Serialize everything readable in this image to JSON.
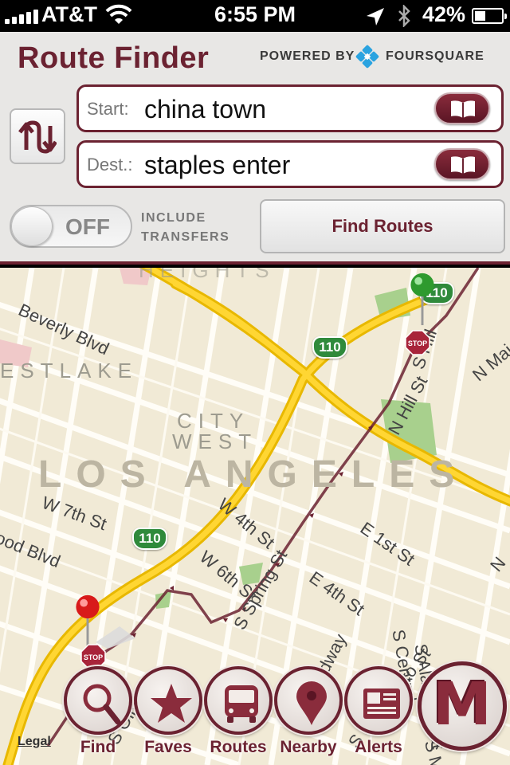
{
  "status_bar": {
    "carrier": "AT&T",
    "time": "6:55 PM",
    "battery_percent_text": "42%",
    "battery_level": 0.42,
    "icons": [
      "signal-icon",
      "wifi-icon",
      "location-icon",
      "bluetooth-icon",
      "battery-icon"
    ]
  },
  "header": {
    "title": "Route Finder",
    "powered_by": "POWERED BY",
    "partner": "FOURSQUARE",
    "brand_color": "#6b2231"
  },
  "form": {
    "start_label": "Start:",
    "start_value": "china town",
    "dest_label": "Dest.:",
    "dest_value": "staples enter",
    "toggle_state": "OFF",
    "include_transfers_label": "INCLUDE TRANSFERS",
    "find_routes_label": "Find Routes"
  },
  "map": {
    "city": "LOS ANGELES",
    "districts": [
      "ESTLAKE",
      "CITY",
      "WEST",
      "HEIGHTS"
    ],
    "streets": [
      "Beverly Blvd",
      "W 7th St",
      "ood Blvd",
      "W 4th St",
      "W 6th St",
      "S Spring St",
      "E 4th St",
      "E 1st St",
      "N Hill St",
      "N Mai",
      "S Hill",
      "S Broadway",
      "S Main",
      "S San Pedro St",
      "S Central",
      "S Alameda St",
      "S Olive",
      "N"
    ],
    "highway_shields": [
      "110",
      "110",
      "110"
    ],
    "legal_link": "Legal",
    "markers": [
      "green-pin",
      "red-pin"
    ],
    "stop_label": "STOP"
  },
  "tabs": [
    {
      "label": "Find",
      "icon": "magnifier-icon"
    },
    {
      "label": "Faves",
      "icon": "star-icon"
    },
    {
      "label": "Routes",
      "icon": "bus-icon"
    },
    {
      "label": "Nearby",
      "icon": "location-pin-icon"
    },
    {
      "label": "Alerts",
      "icon": "newspaper-icon"
    }
  ],
  "metro_button": {
    "letter": "M"
  }
}
